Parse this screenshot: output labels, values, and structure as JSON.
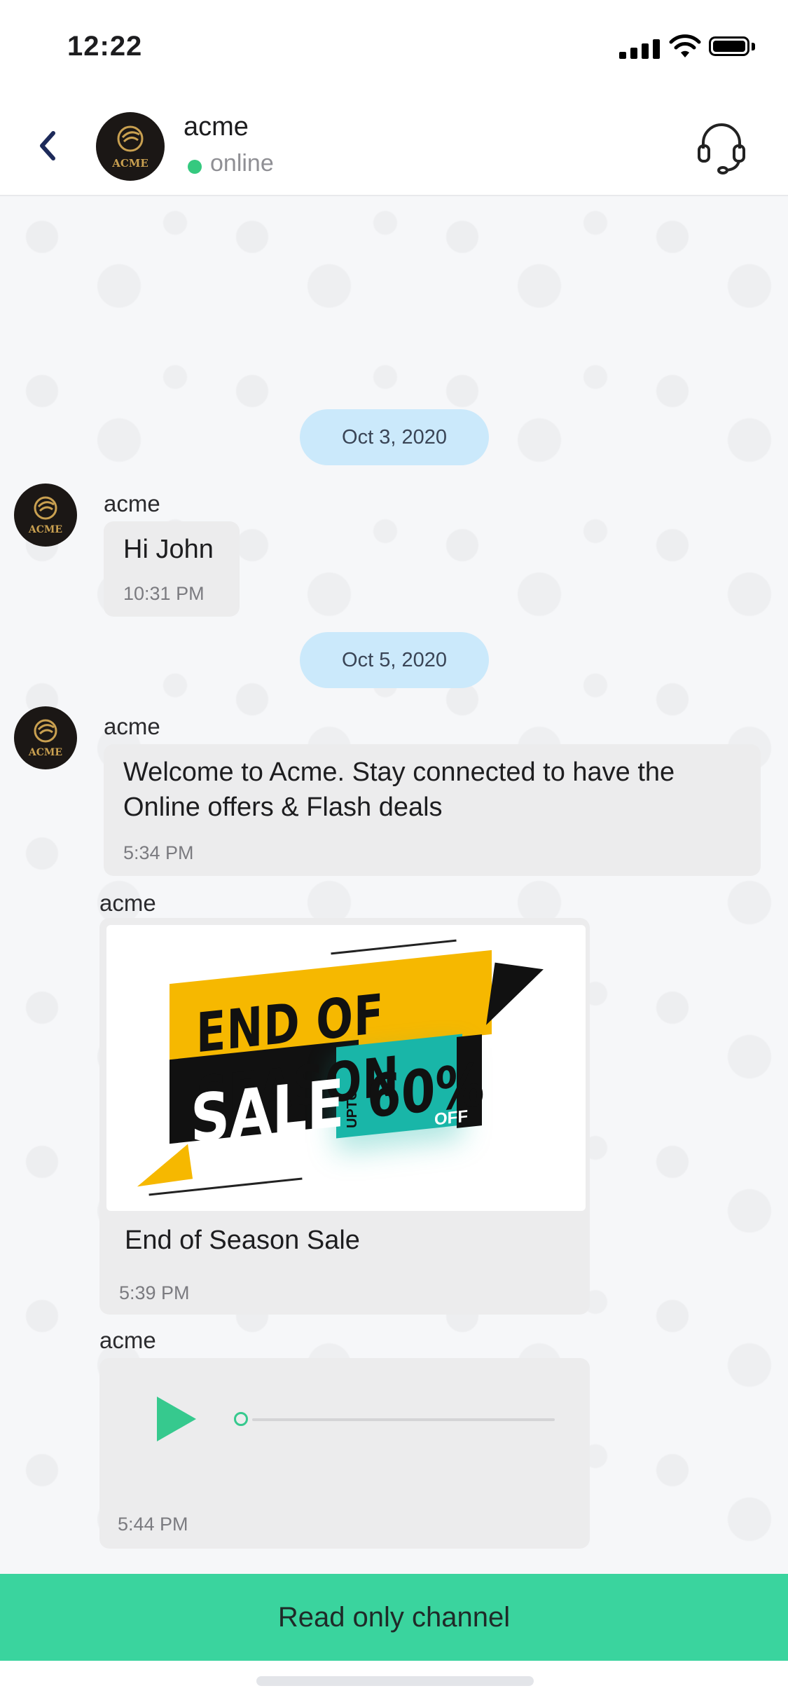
{
  "status_bar": {
    "time": "12:22"
  },
  "header": {
    "title": "acme",
    "status": "online",
    "avatar_text": "ACME"
  },
  "chat": {
    "dates": [
      "Oct 3, 2020",
      "Oct 5, 2020"
    ],
    "messages": [
      {
        "sender": "acme",
        "text": "Hi John",
        "time": "10:31 PM"
      },
      {
        "sender": "acme",
        "text_line1": "Welcome to Acme. Stay connected to have the",
        "text_line2": "Online offers & Flash deals",
        "time": "5:34 PM"
      },
      {
        "sender": "acme",
        "caption": "End of Season Sale",
        "time": "5:39 PM",
        "image": {
          "line1": "END OF SEASON",
          "line2": "SALE",
          "upto": "UPTO",
          "percent": "60%",
          "off": "OFF"
        }
      },
      {
        "sender": "acme",
        "type": "audio",
        "time": "5:44 PM",
        "progress": 0
      }
    ],
    "avatar_text": "ACME"
  },
  "footer": {
    "label": "Read only channel"
  },
  "colors": {
    "accent": "#3ad49e",
    "date_pill": "#cbe9fb",
    "online": "#35c97f",
    "bubble": "#ececed"
  },
  "icons": [
    "back-arrow-icon",
    "headset-icon",
    "play-icon",
    "signal-icon",
    "wifi-icon",
    "battery-icon"
  ]
}
